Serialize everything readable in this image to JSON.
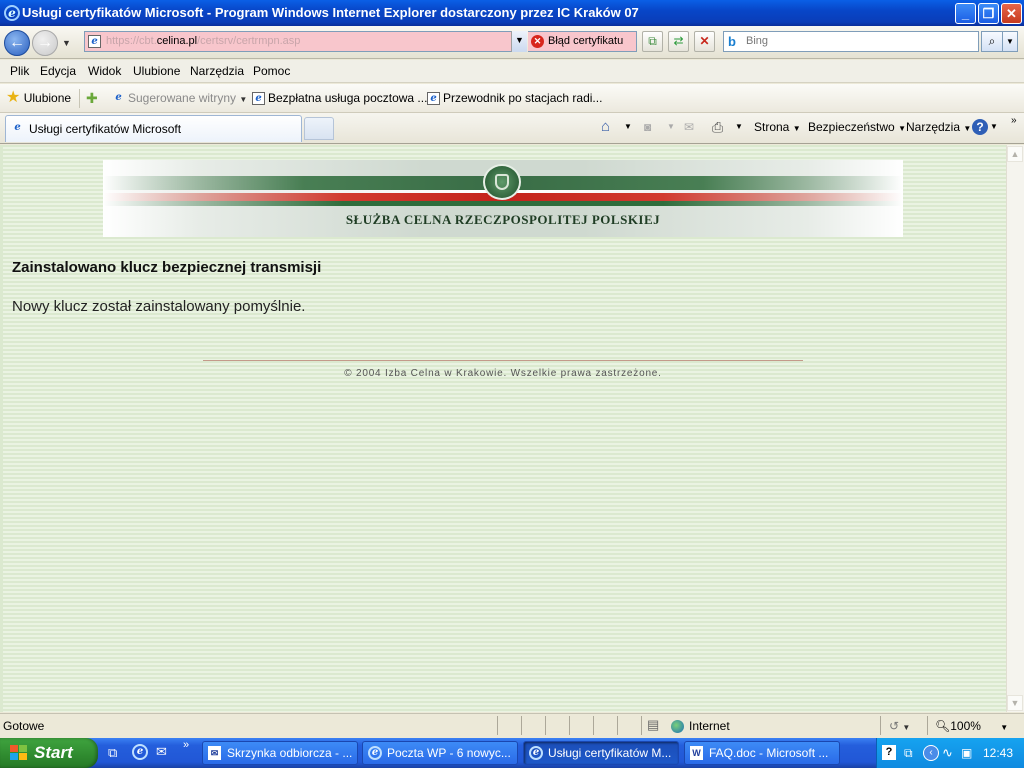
{
  "window": {
    "title": "Usługi certyfikatów Microsoft - Program Windows Internet Explorer dostarczony przez IC Kraków 07"
  },
  "address": {
    "prefix": "https://cbt.",
    "domain": "celina.pl",
    "path": "/certsrv/certrmpn.asp",
    "cert_error": "Błąd certyfikatu"
  },
  "search": {
    "placeholder": "Bing"
  },
  "menu": [
    "Plik",
    "Edycja",
    "Widok",
    "Ulubione",
    "Narzędzia",
    "Pomoc"
  ],
  "favorites": {
    "label": "Ulubione",
    "suggested": "Sugerowane witryny",
    "links": [
      "Bezpłatna usługa pocztowa ...",
      "Przewodnik po stacjach radi..."
    ]
  },
  "tab": {
    "title": "Usługi certyfikatów Microsoft"
  },
  "commands": {
    "page": "Strona",
    "security": "Bezpieczeństwo",
    "tools": "Narzędzia"
  },
  "banner": {
    "text": "SŁUŻBA CELNA RZECZPOSPOLITEJ POLSKIEJ"
  },
  "page": {
    "heading": "Zainstalowano klucz bezpiecznej transmisji",
    "message": "Nowy klucz został zainstalowany pomyślnie.",
    "footer": "© 2004 Izba Celna w Krakowie. Wszelkie prawa zastrzeżone."
  },
  "status": {
    "text": "Gotowe",
    "zone": "Internet",
    "zoom": "100%"
  },
  "taskbar": {
    "start": "Start",
    "items": [
      "Skrzynka odbiorcza - ...",
      "Poczta WP - 6 nowyc...",
      "Usługi certyfikatów M...",
      "FAQ.doc - Microsoft ..."
    ],
    "clock": "12:43"
  }
}
